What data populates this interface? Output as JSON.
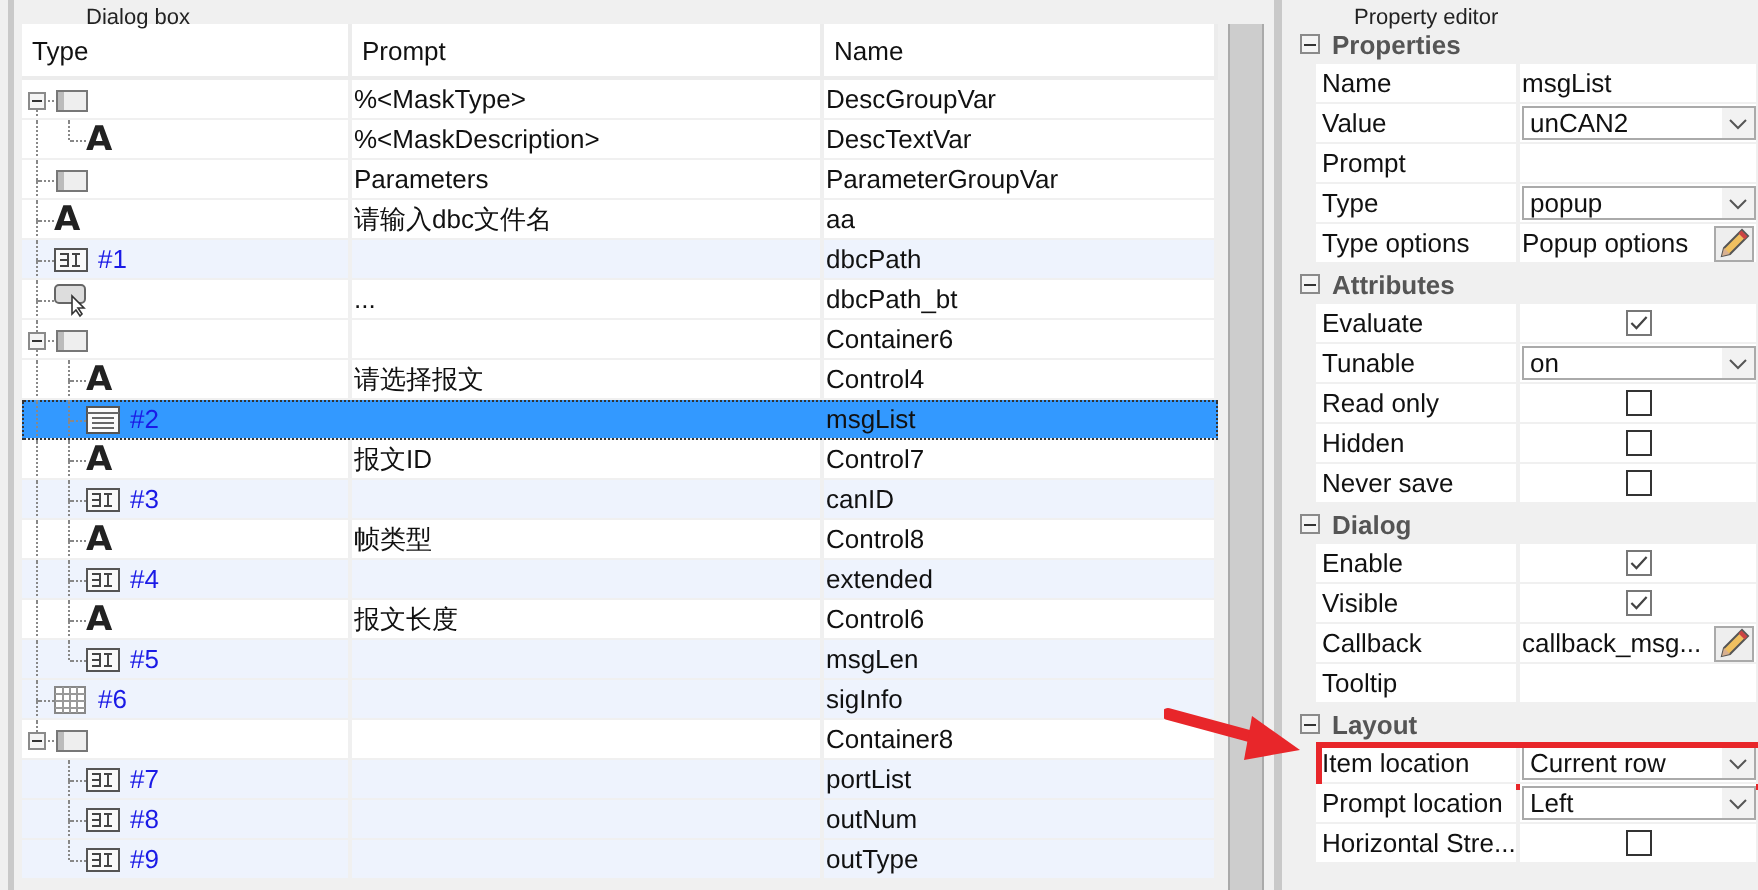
{
  "dialog_box": {
    "title": "Dialog box",
    "columns": [
      "Type",
      "Prompt",
      "Name"
    ],
    "rows": [
      {
        "kind": "group",
        "prompt": "%<MaskType>",
        "name": "DescGroupVar",
        "expanded": true,
        "selected": false,
        "children": [
          {
            "kind": "text",
            "glyph": "A",
            "prompt": "%<MaskDescription>",
            "name": "DescTextVar",
            "selected": false
          }
        ]
      },
      {
        "kind": "group",
        "prompt": "Parameters",
        "name": "ParameterGroupVar",
        "selected": false
      },
      {
        "kind": "text",
        "glyph": "A",
        "prompt": "请输入dbc文件名",
        "name": "aa",
        "selected": false
      },
      {
        "kind": "edit",
        "type_label": "#1",
        "name": "dbcPath",
        "selected": false
      },
      {
        "kind": "button",
        "prompt": "...",
        "name": "dbcPath_bt",
        "selected": false
      },
      {
        "kind": "group",
        "name": "Container6",
        "expanded": true,
        "selected": false,
        "children": [
          {
            "kind": "text",
            "glyph": "A",
            "prompt": "请选择报文",
            "name": "Control4",
            "selected": false
          },
          {
            "kind": "listbox",
            "type_label": "#2",
            "name": "msgList",
            "selected": true
          },
          {
            "kind": "text",
            "glyph": "A",
            "prompt": "报文ID",
            "name": "Control7",
            "selected": false
          },
          {
            "kind": "edit",
            "type_label": "#3",
            "name": "canID",
            "selected": false
          },
          {
            "kind": "text",
            "glyph": "A",
            "prompt": "帧类型",
            "name": "Control8",
            "selected": false
          },
          {
            "kind": "edit",
            "type_label": "#4",
            "name": "extended",
            "selected": false
          },
          {
            "kind": "text",
            "glyph": "A",
            "prompt": "报文长度",
            "name": "Control6",
            "selected": false
          },
          {
            "kind": "edit",
            "type_label": "#5",
            "name": "msgLen",
            "selected": false
          }
        ]
      },
      {
        "kind": "table",
        "type_label": "#6",
        "name": "sigInfo",
        "selected": false
      },
      {
        "kind": "group",
        "name": "Container8",
        "expanded": true,
        "selected": false,
        "children": [
          {
            "kind": "edit",
            "type_label": "#7",
            "name": "portList",
            "selected": false
          },
          {
            "kind": "edit",
            "type_label": "#8",
            "name": "outNum",
            "selected": false
          },
          {
            "kind": "edit",
            "type_label": "#9",
            "name": "outType",
            "selected": false
          }
        ]
      }
    ]
  },
  "property_editor": {
    "title": "Property editor",
    "sections": [
      {
        "title": "Properties",
        "expanded": true,
        "rows": [
          {
            "kind": "text",
            "label": "Name",
            "value": "msgList"
          },
          {
            "kind": "dropdown",
            "label": "Value",
            "value": "unCAN2"
          },
          {
            "kind": "text",
            "label": "Prompt"
          },
          {
            "kind": "dropdown",
            "label": "Type",
            "value": "popup"
          },
          {
            "kind": "editor",
            "label": "Type options",
            "value": "Popup options"
          }
        ]
      },
      {
        "title": "Attributes",
        "expanded": true,
        "rows": [
          {
            "kind": "checkbox",
            "label": "Evaluate",
            "checked": true
          },
          {
            "kind": "dropdown",
            "label": "Tunable",
            "value": "on"
          },
          {
            "kind": "checkbox",
            "label": "Read only",
            "checked": false
          },
          {
            "kind": "checkbox",
            "label": "Hidden",
            "checked": false
          },
          {
            "kind": "checkbox",
            "label": "Never save",
            "checked": false
          }
        ]
      },
      {
        "title": "Dialog",
        "expanded": true,
        "rows": [
          {
            "kind": "checkbox",
            "label": "Enable",
            "checked": true
          },
          {
            "kind": "checkbox",
            "label": "Visible",
            "checked": true
          },
          {
            "kind": "editor",
            "label": "Callback",
            "value": "callback_msg..."
          },
          {
            "kind": "text",
            "label": "Tooltip"
          }
        ]
      },
      {
        "title": "Layout",
        "expanded": true,
        "rows": [
          {
            "kind": "dropdown",
            "label": "Item location",
            "value": "Current row",
            "highlighted": true
          },
          {
            "kind": "dropdown",
            "label": "Prompt location",
            "value": "Left"
          },
          {
            "kind": "checkbox",
            "label": "Horizontal Stre...",
            "checked": false
          }
        ]
      }
    ]
  }
}
